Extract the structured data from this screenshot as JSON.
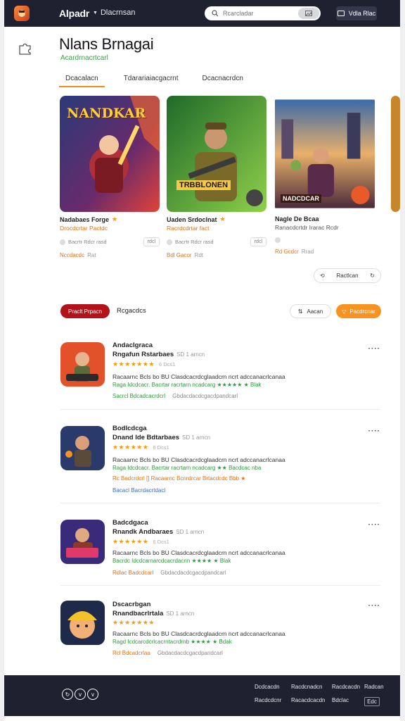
{
  "header": {
    "brand": "Alpadr",
    "nav_label": "Dlacrnsan",
    "search_placeholder": "Rcarcladar",
    "account_label": "Vdla Rlac"
  },
  "page": {
    "title": "Nlans Brnagai",
    "subtitle": "Acardrnacrtcarl"
  },
  "tabs": [
    {
      "label": "Dcacalacn",
      "active": true
    },
    {
      "label": "Tdarariaiacgacrnt",
      "active": false
    },
    {
      "label": "Dcacnacrdcn",
      "active": false
    }
  ],
  "featured": [
    {
      "title": "Nadabaes Forge",
      "sub": "Drocdcrtar Pactdc",
      "meta": "Bacrtr Rdcr rasd",
      "pill": "rdcl",
      "foot": "Nccdacdc",
      "foot2": "Rat",
      "art": "NANDKAR"
    },
    {
      "title": "Uaden Srdoclnat",
      "sub": "Racrdcdrtar fact",
      "meta": "Bacrtr Rdcr rasd",
      "pill": "rdcl",
      "foot": "Bdl Gacor",
      "foot2": "Rdt",
      "art": "TRBBLONEN"
    },
    {
      "title": "Nagle De Bcaa",
      "sub": "Ranacdcrtdr Irarac Rcdr",
      "meta": "",
      "pill": "",
      "foot": "Rd Gcdcr",
      "foot2": "Rrad",
      "art": "NADCDCAR"
    }
  ],
  "more_label": "Ractlcan",
  "filters": {
    "primary": "Praclt Prpacn",
    "label": "Rcgacdcs",
    "secondary": "Aacan",
    "orange": "Pacdrcnar"
  },
  "list": [
    {
      "heading": "Andaclgraca",
      "title": "Rngafun Rstarbaes",
      "tag": "SD 1 arncn",
      "stars": "★★★★★★★",
      "rating": "6 Dcs1",
      "desc": "Racaarnc Bcls bo BU Clasdcacrdcglaadcrn ncrt adccanacrlcanaa",
      "desc2": "Raga Idcdcacr. Bacrtar racrtarn ncadcarg ★★★★★ ★ Blak",
      "link": "Sacrcl Bdcadcacrdcrl",
      "link2": "Gbdacdacdcgacdpandcarl",
      "link_color": "green",
      "art": "ladder"
    },
    {
      "heading": "Bodlcdcga",
      "title": "Dnand Ide Bdtarbaes",
      "tag": "SD 1 arncn",
      "stars": "★★★★★★",
      "rating": "6 Dcs1",
      "desc": "Racaarnc Bcls bo BU Clasdcacrdcglaadcrn ncrt adccanacrlcanaa",
      "desc2": "Raga Idcdcacr. Bacrtar racrtarn ncadcarg ★★ Bacdcac nba",
      "desc3": "Rc Badcrdcrl [] Racaarnc Bcnrdrcar Brtacdcdc Bbb ★",
      "link": "Bacacl Bacrdacrtdacl",
      "link2": "",
      "link_color": "blue",
      "art": "soldier"
    },
    {
      "heading": "Badcdgaca",
      "title": "Rnandk Andbaraes",
      "tag": "SD 1 arncn",
      "stars": "★★★★★★",
      "rating": "6 Dcs1",
      "desc": "Racaarnc Bcls bo BU Clasdcacrdcglaadcrn ncrt adccanacrlcanaa",
      "desc2": "Bacrdc Idcdcarnarcdcacrdacnn ★★★★ ★ Blak",
      "link": "Rdlac Badcdcarl",
      "link2": "Gbdacdacdcgacdpandcarl",
      "link_color": "orange",
      "art": "hero"
    },
    {
      "heading": "Dscacrbgan",
      "title": "Rnandbacrlrtala",
      "tag": "SD 1 arncn",
      "stars": "★★★★★★★",
      "rating": "",
      "desc": "Racaarnc Bcls bo BU Clasdcacrdcglaadcrn ncrt adccanacrlcanaa",
      "desc2": "Ragd Icdcarcdcrlcacrntacrdrnb ★★★★ ★ Bdak",
      "link": "Rcl Bdcadcrlaa",
      "link2": "Gbdacdacdcgacdpandcarl",
      "link_color": "orange",
      "art": "miner"
    }
  ],
  "footer": {
    "icons": [
      "circle-icon",
      "chevron-icon",
      "chevron-icon"
    ],
    "links_row1": [
      "Dcdcacdn",
      "Racdcnadcn",
      "Racdcacdn",
      "Radcan"
    ],
    "links_row2": [
      "Racdcdcnr",
      "Racacdcacdn",
      "Bdclac",
      "Edc"
    ]
  },
  "colors": {
    "accent_orange": "#f7931e",
    "accent_red": "#b4121a",
    "header_bg": "#1f2130",
    "green": "#3aa24a"
  }
}
